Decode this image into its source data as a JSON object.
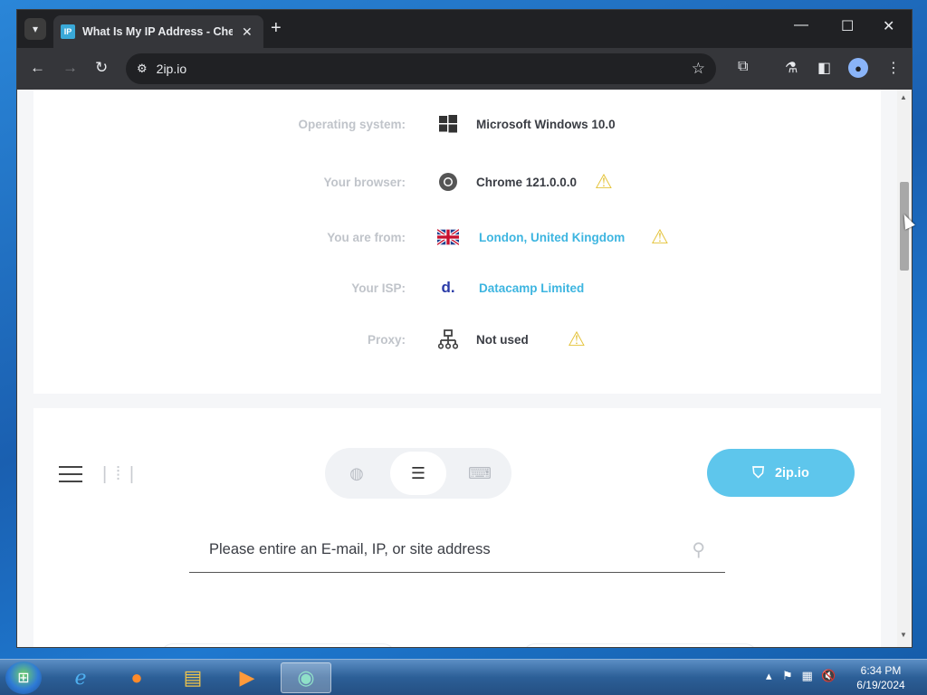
{
  "browser": {
    "tab_title": "What Is My IP Address - Check",
    "favicon_text": "IP",
    "url": "2ip.io",
    "colors": {
      "frame": "#202124",
      "toolbar": "#35363a",
      "accent": "#5ec6ec"
    }
  },
  "info_rows": [
    {
      "label": "Operating system:",
      "value": "Microsoft Windows 10.0",
      "icon": "windows-icon",
      "warn": false,
      "link": false
    },
    {
      "label": "Your browser:",
      "value": "Chrome 121.0.0.0",
      "icon": "chrome-icon",
      "warn": true,
      "link": false
    },
    {
      "label": "You are from:",
      "value": "London, United Kingdom",
      "icon": "uk-flag-icon",
      "warn": true,
      "link": true
    },
    {
      "label": "Your ISP:",
      "value": "Datacamp Limited",
      "icon": "datacamp-icon",
      "warn": false,
      "link": true
    },
    {
      "label": "Proxy:",
      "value": "Not used",
      "icon": "network-icon",
      "warn": true,
      "link": false
    }
  ],
  "isp_logo_text": "d.",
  "tools": {
    "brand_button": "2ip.io",
    "search_placeholder": "Please entire an E-mail, IP, or site address"
  },
  "taskbar": {
    "time": "6:34 PM",
    "date": "6/19/2024"
  }
}
